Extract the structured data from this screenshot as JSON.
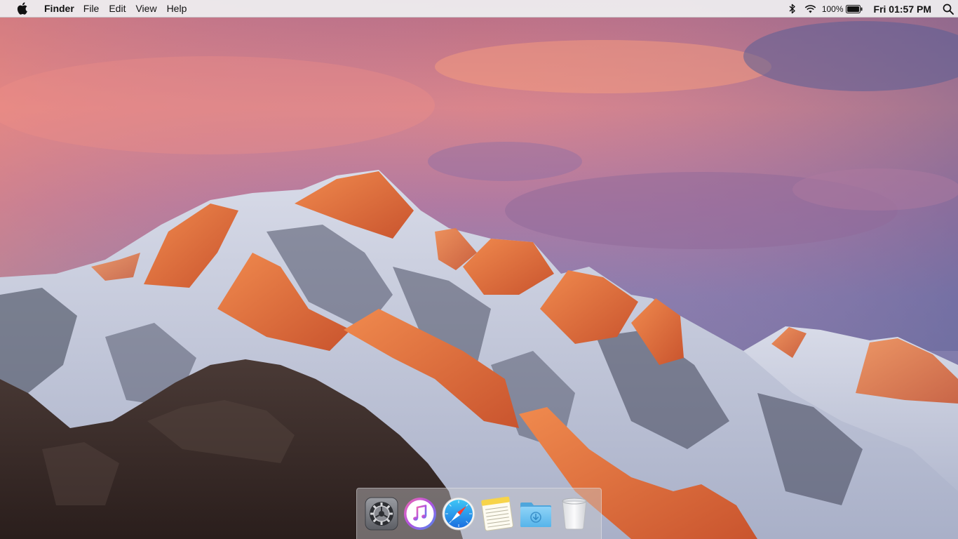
{
  "menubar": {
    "apple_icon": "apple-logo-icon",
    "app_name": "Finder",
    "menus": [
      "File",
      "Edit",
      "View",
      "Help"
    ],
    "status": {
      "bluetooth_icon": "bluetooth-icon",
      "wifi_icon": "wifi-icon",
      "battery_percent": "100%",
      "battery_level": 1.0,
      "battery_icon": "battery-icon",
      "clock": "Fri 01:57 PM",
      "spotlight_icon": "spotlight-search-icon"
    }
  },
  "dock": {
    "items": [
      {
        "name": "System Preferences",
        "icon": "system-preferences-icon"
      },
      {
        "name": "iTunes",
        "icon": "itunes-icon"
      },
      {
        "name": "Safari",
        "icon": "safari-icon"
      },
      {
        "name": "Notes",
        "icon": "notes-icon"
      },
      {
        "name": "Downloads",
        "icon": "downloads-folder-icon"
      },
      {
        "name": "Trash",
        "icon": "trash-icon"
      }
    ]
  },
  "colors": {
    "menubar_bg": "#eeeef0",
    "sky_top": "#c97a8a",
    "sky_mid": "#9a7cae",
    "alpenglow": "#e0703e",
    "snow": "#e6e8f0",
    "rock_dark": "#3a2a26"
  }
}
